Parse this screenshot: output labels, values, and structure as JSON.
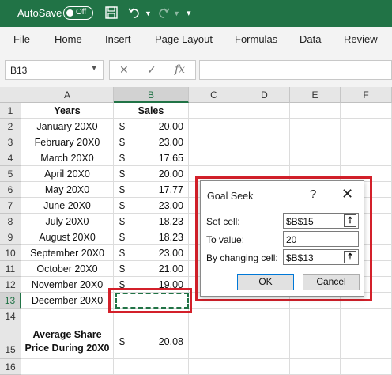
{
  "titlebar": {
    "autosave_label": "AutoSave",
    "autosave_state": "Off",
    "icons": [
      "save-icon",
      "undo-icon",
      "undo-dropdown-icon",
      "redo-icon",
      "redo-dropdown-icon",
      "customize-qat-icon"
    ]
  },
  "ribbon": {
    "tabs": [
      "File",
      "Home",
      "Insert",
      "Page Layout",
      "Formulas",
      "Data",
      "Review"
    ]
  },
  "formula_bar": {
    "name_box": "B13",
    "cancel_icon": "✕",
    "enter_icon": "✓",
    "fx_label": "fx",
    "formula": ""
  },
  "sheet": {
    "columns": [
      "A",
      "B",
      "C",
      "D",
      "E",
      "F"
    ],
    "row_numbers": [
      "1",
      "2",
      "3",
      "4",
      "5",
      "6",
      "7",
      "8",
      "9",
      "10",
      "11",
      "12",
      "13",
      "14",
      "15",
      "16"
    ],
    "header": {
      "years": "Years",
      "sales": "Sales"
    },
    "rows": [
      {
        "year": "January 20X0",
        "currency": "$",
        "amount": "20.00"
      },
      {
        "year": "February 20X0",
        "currency": "$",
        "amount": "23.00"
      },
      {
        "year": "March 20X0",
        "currency": "$",
        "amount": "17.65"
      },
      {
        "year": "April 20X0",
        "currency": "$",
        "amount": "20.00"
      },
      {
        "year": "May 20X0",
        "currency": "$",
        "amount": "17.77"
      },
      {
        "year": "June 20X0",
        "currency": "$",
        "amount": "23.00"
      },
      {
        "year": "July 20X0",
        "currency": "$",
        "amount": "18.23"
      },
      {
        "year": "August 20X0",
        "currency": "$",
        "amount": "18.23"
      },
      {
        "year": "September 20X0",
        "currency": "$",
        "amount": "23.00"
      },
      {
        "year": "October 20X0",
        "currency": "$",
        "amount": "21.00"
      },
      {
        "year": "November 20X0",
        "currency": "$",
        "amount": "19.00"
      },
      {
        "year": "December 20X0",
        "currency": "",
        "amount": ""
      }
    ],
    "average": {
      "line1": "Average Share",
      "line2": "Price During 20X0",
      "currency": "$",
      "amount": "20.08"
    },
    "selected_cell": "B13"
  },
  "goal_seek": {
    "title": "Goal Seek",
    "help": "?",
    "close": "✕",
    "set_cell_label": "Set cell:",
    "set_cell_value": "$B$15",
    "to_value_label": "To value:",
    "to_value_value": "20",
    "changing_cell_label": "By changing cell:",
    "changing_cell_value": "$B$13",
    "ok_label": "OK",
    "cancel_label": "Cancel"
  },
  "colors": {
    "excel_green": "#217346",
    "highlight_red": "#d3202a"
  }
}
